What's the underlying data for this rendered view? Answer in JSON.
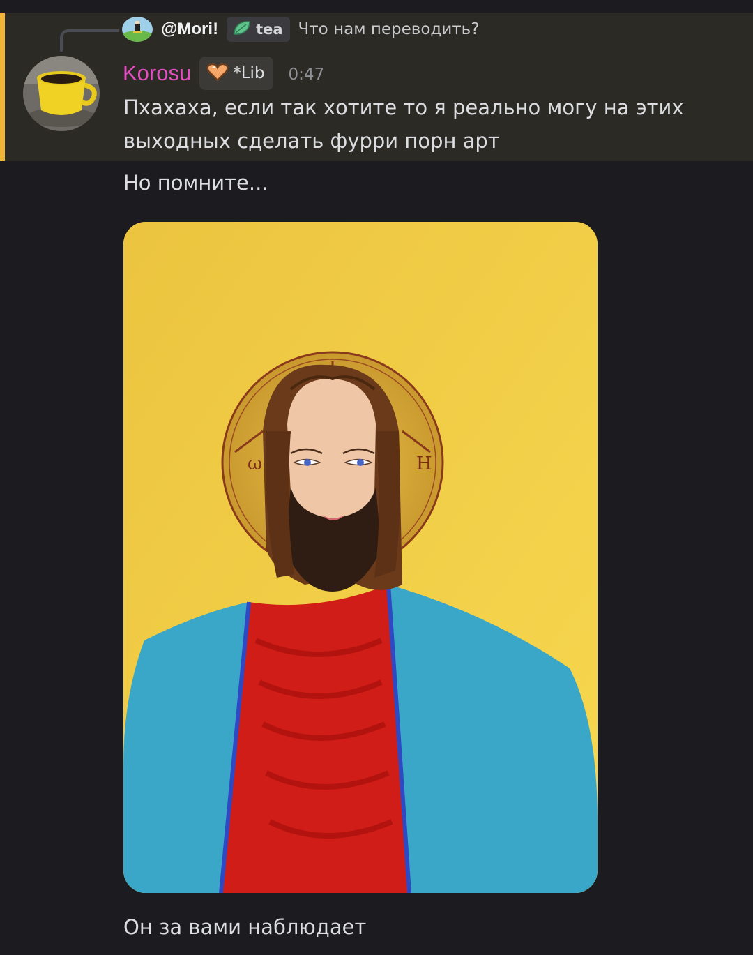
{
  "reply": {
    "username": "@Mori!",
    "tag_label": "tea",
    "text": "Что нам переводить?"
  },
  "message": {
    "author": "Korosu",
    "role_label": "*Lib",
    "timestamp": "0:47",
    "lines": [
      "Пхахаха, если так хотите то я реально могу на этих выходных сделать фурри порн арт",
      "Но помните...",
      "Он за вами наблюдает"
    ]
  },
  "attachment": {
    "halo_left_glyph": "ω",
    "halo_right_glyph": "Н"
  },
  "colors": {
    "highlight_bg": "#2c2a25",
    "highlight_bar": "#f2b436",
    "author_color": "#e14fc1",
    "background": "#1b1b20"
  }
}
